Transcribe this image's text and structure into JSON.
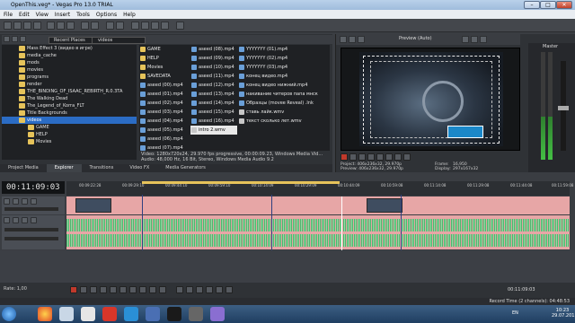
{
  "window": {
    "title": "OpenThis.veg* - Vegas Pro 13.0 TRIAL",
    "min": "–",
    "max": "□",
    "close": "✕"
  },
  "menu": [
    "File",
    "Edit",
    "View",
    "Insert",
    "Tools",
    "Options",
    "Help"
  ],
  "explorer": {
    "recent_label": "Recent Places",
    "address": "videos",
    "tree": [
      {
        "label": "Mass Effect 3 (видео в игре)"
      },
      {
        "label": "media_cache"
      },
      {
        "label": "mods"
      },
      {
        "label": "movies"
      },
      {
        "label": "programs"
      },
      {
        "label": "render"
      },
      {
        "label": "THE_BINDING_OF_ISAAC_REBIRTH_R.0.3TA"
      },
      {
        "label": "The Walking Dead"
      },
      {
        "label": "The_Legend_of_Korra_FLT"
      },
      {
        "label": "Title Backgrounds"
      },
      {
        "label": "videos",
        "selected": true
      },
      {
        "label": "GAME",
        "sub": true
      },
      {
        "label": "HELP",
        "sub": true
      },
      {
        "label": "Movies",
        "sub": true
      }
    ],
    "files_col1": [
      {
        "name": "GAME",
        "type": "folder"
      },
      {
        "name": "HELP",
        "type": "folder"
      },
      {
        "name": "Movies",
        "type": "folder"
      },
      {
        "name": "SAVEDATA",
        "type": "folder"
      },
      {
        "name": "aseed (00).mp4",
        "type": "mp4"
      },
      {
        "name": "aseed (01).mp4",
        "type": "mp4"
      },
      {
        "name": "aseed (02).mp4",
        "type": "mp4"
      },
      {
        "name": "aseed (03).mp4",
        "type": "mp4"
      },
      {
        "name": "aseed (04).mp4",
        "type": "mp4"
      },
      {
        "name": "aseed (05).mp4",
        "type": "mp4"
      },
      {
        "name": "aseed (06).mp4",
        "type": "mp4"
      },
      {
        "name": "aseed (07).mp4",
        "type": "mp4"
      }
    ],
    "files_col2": [
      {
        "name": "aseed (08).mp4",
        "type": "mp4"
      },
      {
        "name": "aseed (09).mp4",
        "type": "mp4"
      },
      {
        "name": "aseed (10).mp4",
        "type": "mp4"
      },
      {
        "name": "aseed (11).mp4",
        "type": "mp4"
      },
      {
        "name": "aseed (12).mp4",
        "type": "mp4"
      },
      {
        "name": "aseed (13).mp4",
        "type": "mp4"
      },
      {
        "name": "aseed (14).mp4",
        "type": "mp4"
      },
      {
        "name": "aseed (15).mp4",
        "type": "mp4"
      },
      {
        "name": "aseed (16).mp4",
        "type": "mp4"
      },
      {
        "name": "intro 2.wmv",
        "type": "wmv"
      }
    ],
    "files_col3": [
      {
        "name": "YYYYYYY (01).mp4",
        "type": "mp4"
      },
      {
        "name": "YYYYYYY (02).mp4",
        "type": "mp4"
      },
      {
        "name": "YYYYYYY (03).mp4",
        "type": "mp4"
      },
      {
        "name": "конец видео.mp4",
        "type": "mp4"
      },
      {
        "name": "конец видео нижний.mp4",
        "type": "mp4"
      },
      {
        "name": "накивание читеров папа мнск",
        "type": "mp4"
      },
      {
        "name": "Образцы (movee Reveal) .lnk",
        "type": "mp4"
      },
      {
        "name": "ставь лайк.wmv",
        "type": "wmv"
      },
      {
        "name": "текст сколько лет.wmv",
        "type": "wmv"
      }
    ],
    "info_line1": "Video: 1280x720x24, 29.970 fps progressive, 00:00:09.23, Windows Media Vid...",
    "info_line2": "Audio: 48,000 Hz, 16 Bit, Stereo, Windows Media Audio 9.2"
  },
  "tabs": [
    "Project Media",
    "Explorer",
    "Transitions",
    "Video FX",
    "Media Generators"
  ],
  "active_tab": "Explorer",
  "preview": {
    "quality": "Preview (Auto)",
    "project": "Project:  406x236x32, 29.970p",
    "preview": "Preview:  406x236x32, 29.970p",
    "frame_label": "Frame:",
    "frame": "16,950",
    "display_label": "Display:",
    "display": "297x167x32"
  },
  "master": {
    "label": "Master"
  },
  "timeline": {
    "timecode": "00:11:09:03",
    "ticks": [
      "00:09:22:28",
      "00:09:29:10",
      "00:09:44:10",
      "00:09:59:10",
      "00:10:14:09",
      "00:10:29:09",
      "00:10:44:09",
      "00:10:59:08",
      "00:11:14:08",
      "00:11:29:08",
      "00:11:44:08",
      "00:11:59:08"
    ],
    "rate_label": "Rate: 1,00",
    "end_tc": "00:11:09:03",
    "icons_color": "#e7a6a6"
  },
  "status": {
    "text": "Record Time (2 channels): 04:48:53"
  },
  "taskbar": {
    "lang": "EN",
    "time": "10:23",
    "date": "29.07.2015"
  }
}
